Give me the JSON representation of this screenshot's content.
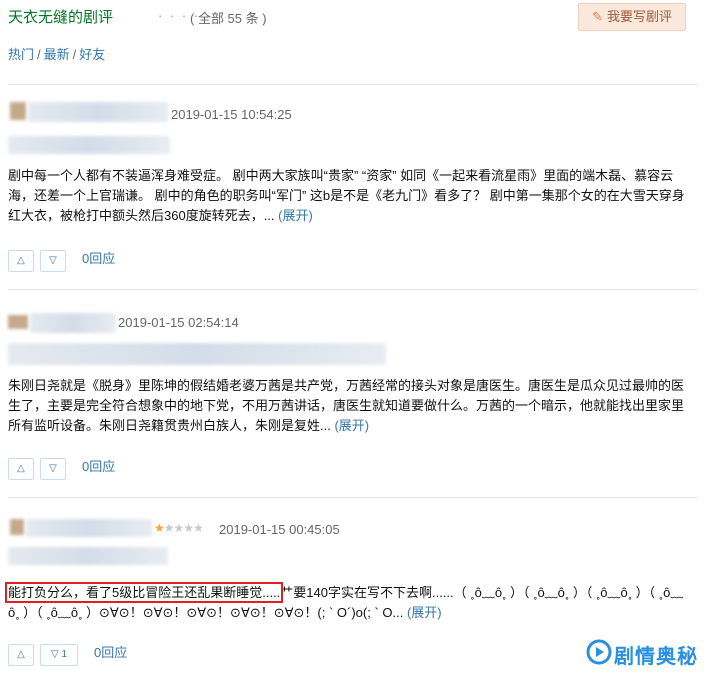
{
  "header": {
    "title": "天衣无缝的剧评",
    "dots": "· · · · · ·",
    "count": "( 全部 55 条 )",
    "write_button": "我要写剧评"
  },
  "filters": {
    "hot": "热门",
    "sep1": "/",
    "latest": "最新",
    "sep2": "/",
    "friends": "好友"
  },
  "reviews": [
    {
      "date": "2019-01-15 10:54:25",
      "rating": null,
      "text": "剧中每一个人都有不装逼浑身难受症。 剧中两大家族叫“贵家” “资家” 如同《一起来看流星雨》里面的端木磊、慕容云海，还差一个上官瑞谦。 剧中的角色的职务叫“军门” 这b是不是《老九门》看多了？ 剧中第一集那个女的在大雪天穿身红大衣，被枪打中额头然后360度旋转死去，... ",
      "more": "(展开)",
      "up_count": "",
      "replies": "0回应"
    },
    {
      "date": "2019-01-15 02:54:14",
      "rating": null,
      "text": "朱刚日尧就是《脱身》里陈坤的假结婚老婆万茜是共产党，万茜经常的接头对象是唐医生。唐医生是瓜众见过最帅的医生了，主要是完全符合想象中的地下党，不用万茜讲话，唐医生就知道要做什么。万茜的一个暗示，他就能找出里家里所有监听设备。朱刚日尧籍贯贵州白族人，朱刚是复姓... ",
      "more": "(展开)",
      "up_count": "",
      "replies": "0回应"
    },
    {
      "date": "2019-01-15 00:45:05",
      "rating": 1,
      "text_highlight": "能打负分么，看了5级比冒险王还乱果断睡觉.....",
      "text": "艹要140字实在写不下去啊......（ ˳ȏ﹏ȏ˳ ）（ ˳ȏ﹏ȏ˳ ）（ ˳ȏ﹏ȏ˳ ）（ ˳ȏ﹏ȏ˳ ）（ ˳ȏ﹏ȏ˳ ）⊙∀⊙！⊙∀⊙！⊙∀⊙！⊙∀⊙！⊙∀⊙！(; ` O´)o(; ` O... ",
      "more": "(展开)",
      "up_count": "1",
      "replies": "0回应"
    }
  ],
  "icons": {
    "up": "triangle-up-icon",
    "down": "triangle-down-icon",
    "pen": "pen-icon",
    "star": "star-icon"
  },
  "watermark": {
    "text": "剧情奥秘"
  },
  "colors": {
    "link": "#3377aa",
    "title": "#007722",
    "highlight_box": "#e02020",
    "star": "#f5a623"
  }
}
